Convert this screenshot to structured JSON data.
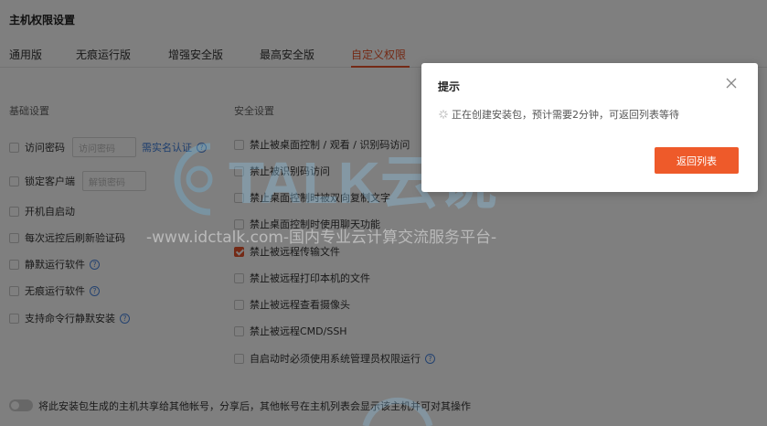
{
  "page": {
    "title": "主机权限设置"
  },
  "tabs": [
    {
      "label": "通用版"
    },
    {
      "label": "无痕运行版"
    },
    {
      "label": "增强安全版"
    },
    {
      "label": "最高安全版"
    },
    {
      "label": "自定义权限"
    }
  ],
  "basic": {
    "title": "基础设置",
    "items": [
      {
        "label": "访问密码",
        "placeholder": "访问密码",
        "link": "需实名认证"
      },
      {
        "label": "锁定客户端",
        "placeholder": "解锁密码"
      },
      {
        "label": "开机自启动"
      },
      {
        "label": "每次远控后刷新验证码"
      },
      {
        "label": "静默运行软件"
      },
      {
        "label": "无痕运行软件"
      },
      {
        "label": "支持命令行静默安装"
      }
    ]
  },
  "security": {
    "title": "安全设置",
    "items": [
      {
        "label": "禁止被桌面控制 / 观看 / 识别码访问"
      },
      {
        "label": "禁止被识别码访问"
      },
      {
        "label": "禁止桌面控制时被双向复制文字"
      },
      {
        "label": "禁止桌面控制时使用聊天功能"
      },
      {
        "label": "禁止被远程传输文件"
      },
      {
        "label": "禁止被远程打印本机的文件"
      },
      {
        "label": "禁止被远程查看摄像头"
      },
      {
        "label": "禁止被远程CMD/SSH"
      },
      {
        "label": "自启动时必须使用系统管理员权限运行"
      }
    ]
  },
  "share": {
    "text": "将此安装包生成的主机共享给其他帐号，分享后，其他帐号在主机列表会显示该主机并可对其操作"
  },
  "watermark": {
    "logo": "TALK云说",
    "url": "-www.idctalk.com-国内专业云计算交流服务平台-"
  },
  "modal": {
    "title": "提示",
    "message": "正在创建安装包，预计需要2分钟，可返回列表等待",
    "button": "返回列表"
  },
  "colors": {
    "accent": "#e8542c",
    "link": "#3b7ddd",
    "button": "#ee5a2a"
  }
}
